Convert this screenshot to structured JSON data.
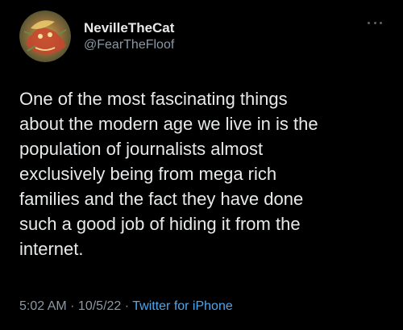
{
  "author": {
    "display_name": "NevilleTheCat",
    "handle": "@FearTheFloof"
  },
  "tweet": {
    "text": "One of the most fascinating things\nabout the modern age we live in is the\npopulation of journalists almost\nexclusively being from mega rich\nfamilies and the fact they have done\nsuch a good job of hiding it from the\ninternet."
  },
  "meta": {
    "time": "5:02 AM",
    "separator": " · ",
    "date": "10/5/22",
    "source": "Twitter for iPhone"
  },
  "icons": {
    "more": "more-options-icon",
    "avatar": "avatar"
  },
  "colors": {
    "background": "#000000",
    "text": "#e7e9ea",
    "secondary_text": "#8b98a5",
    "link": "#4fa6ea"
  }
}
